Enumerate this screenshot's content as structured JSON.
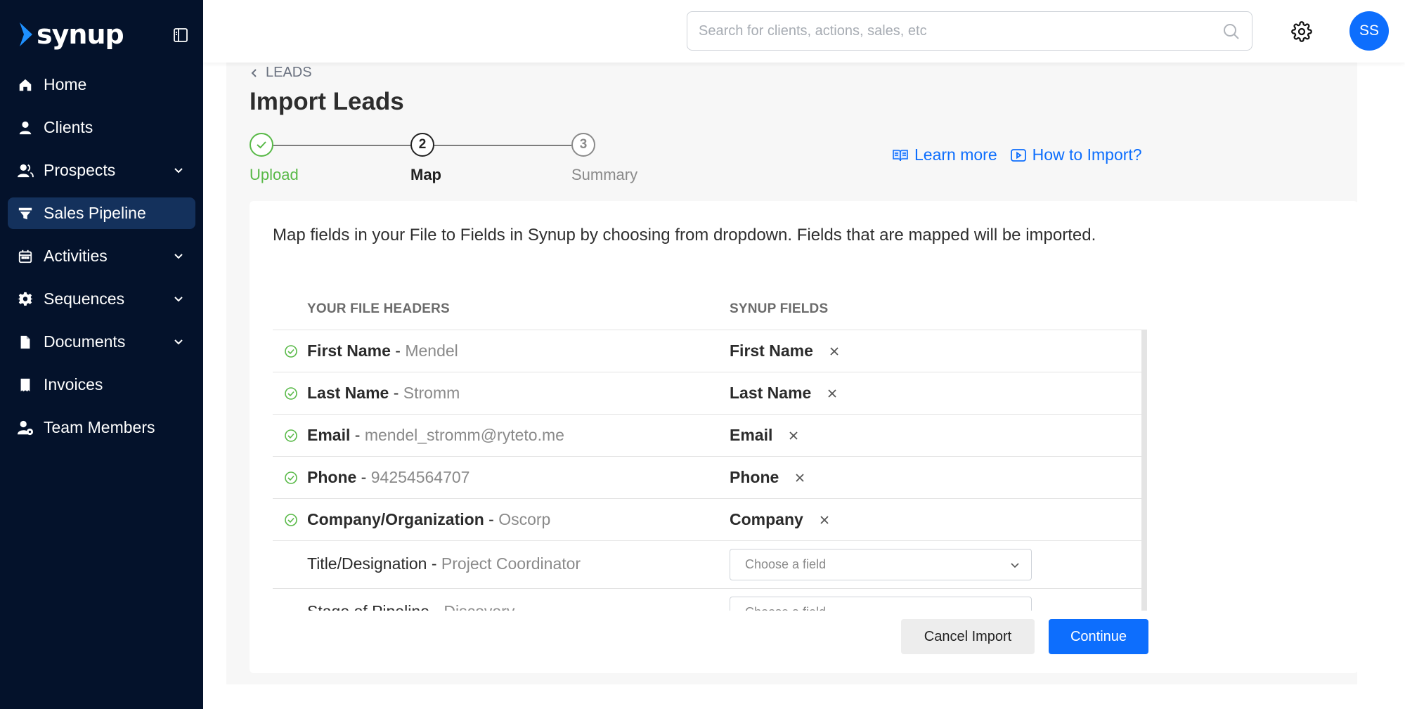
{
  "brand": {
    "name": "synup",
    "logo_color": "#1e90ff"
  },
  "sidebar": {
    "items": [
      {
        "label": "Home",
        "icon": "home-icon",
        "has_chevron": false,
        "active": false
      },
      {
        "label": "Clients",
        "icon": "person-icon",
        "has_chevron": false,
        "active": false
      },
      {
        "label": "Prospects",
        "icon": "prospects-icon",
        "has_chevron": true,
        "active": false
      },
      {
        "label": "Sales Pipeline",
        "icon": "funnel-icon",
        "has_chevron": false,
        "active": true
      },
      {
        "label": "Activities",
        "icon": "calendar-icon",
        "has_chevron": true,
        "active": false
      },
      {
        "label": "Sequences",
        "icon": "gear-icon",
        "has_chevron": true,
        "active": false
      },
      {
        "label": "Documents",
        "icon": "document-icon",
        "has_chevron": true,
        "active": false
      },
      {
        "label": "Invoices",
        "icon": "invoice-icon",
        "has_chevron": false,
        "active": false
      },
      {
        "label": "Team Members",
        "icon": "team-icon",
        "has_chevron": false,
        "active": false
      }
    ]
  },
  "topbar": {
    "search_placeholder": "Search for clients, actions, sales, etc",
    "avatar_initials": "SS",
    "avatar_color": "#0d6efd"
  },
  "breadcrumb": {
    "label": "LEADS"
  },
  "page_title": "Import Leads",
  "stepper": {
    "steps": [
      {
        "number": "",
        "label": "Upload",
        "state": "done"
      },
      {
        "number": "2",
        "label": "Map",
        "state": "current"
      },
      {
        "number": "3",
        "label": "Summary",
        "state": "pending"
      }
    ],
    "done_color": "#58b947"
  },
  "help": {
    "learn_more": "Learn more",
    "how_to_import": "How to Import?"
  },
  "mapping": {
    "instructions": "Map fields in your File to Fields in Synup by choosing from dropdown. Fields that are mapped will be imported.",
    "col_file_headers": "YOUR FILE HEADERS",
    "col_synup_fields": "SYNUP FIELDS",
    "rows": [
      {
        "header": "First Name",
        "sample": "Mendel",
        "mapped": true,
        "synup_field": "First Name"
      },
      {
        "header": "Last Name",
        "sample": "Stromm",
        "mapped": true,
        "synup_field": "Last Name"
      },
      {
        "header": "Email",
        "sample": "mendel_stromm@ryteto.me",
        "mapped": true,
        "synup_field": "Email"
      },
      {
        "header": "Phone",
        "sample": "94254564707",
        "mapped": true,
        "synup_field": "Phone"
      },
      {
        "header": "Company/Organization",
        "sample": "Oscorp",
        "mapped": true,
        "synup_field": "Company"
      },
      {
        "header": "Title/Designation",
        "sample": "Project Coordinator",
        "mapped": false,
        "placeholder": "Choose a field"
      },
      {
        "header": "Stage of Pipeline",
        "sample": "Discovery",
        "mapped": false,
        "placeholder": "Choose a field"
      }
    ]
  },
  "actions": {
    "cancel": "Cancel Import",
    "continue": "Continue"
  },
  "colors": {
    "sidebar_bg": "#04122b",
    "sidebar_active": "#14315c",
    "primary": "#0d6efd",
    "success": "#58b947"
  }
}
